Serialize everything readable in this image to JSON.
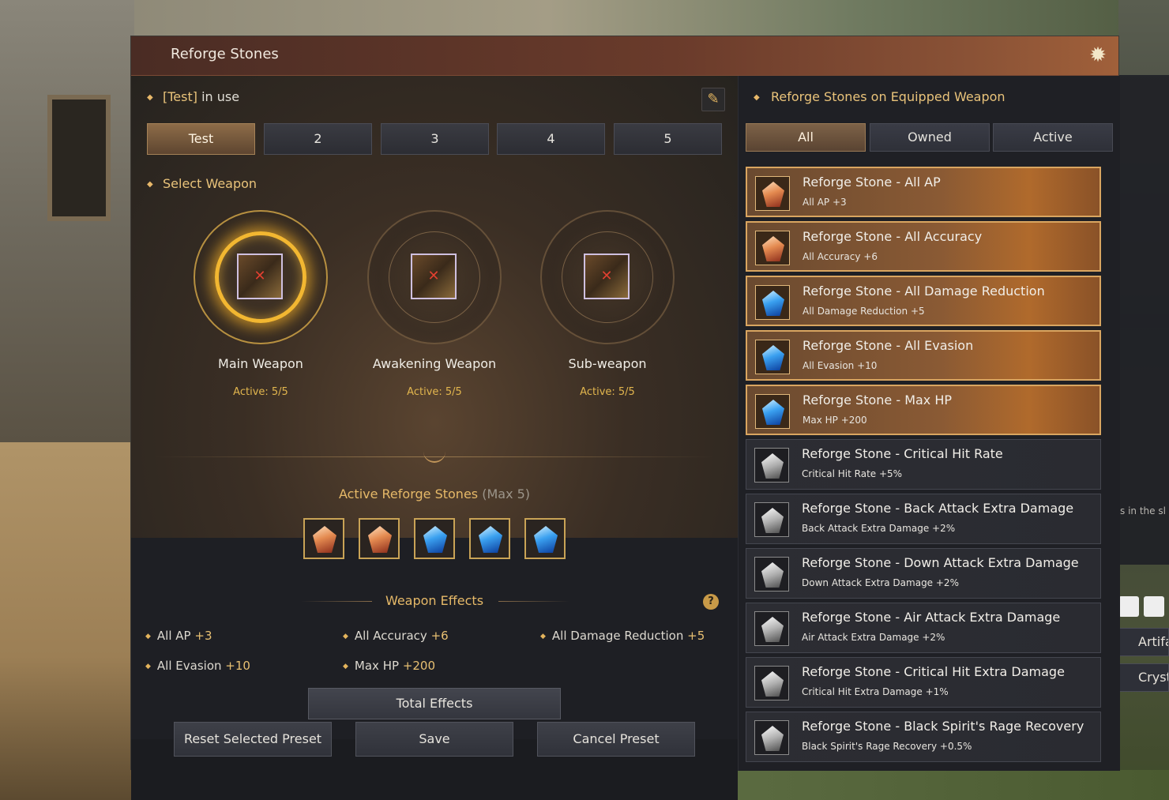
{
  "window": {
    "title": "Reforge Stones"
  },
  "preset": {
    "name": "[Test]",
    "in_use_label": "in use",
    "tabs": [
      "Test",
      "2",
      "3",
      "4",
      "5"
    ],
    "active_tab": 0
  },
  "select_weapon": {
    "label": "Select Weapon",
    "weapons": [
      {
        "name": "Main Weapon",
        "active": "Active: 5/5",
        "selected": true
      },
      {
        "name": "Awakening Weapon",
        "active": "Active: 5/5",
        "selected": false
      },
      {
        "name": "Sub-weapon",
        "active": "Active: 5/5",
        "selected": false
      }
    ]
  },
  "active_stones": {
    "title": "Active Reforge Stones",
    "max_label": "(Max 5)",
    "slots": [
      "red",
      "red",
      "blue",
      "blue",
      "blue"
    ]
  },
  "weapon_effects": {
    "title": "Weapon Effects",
    "items": [
      {
        "label": "All AP",
        "value": "+3"
      },
      {
        "label": "All Accuracy",
        "value": "+6"
      },
      {
        "label": "All Damage Reduction",
        "value": "+5"
      },
      {
        "label": "All Evasion",
        "value": "+10"
      },
      {
        "label": "Max HP",
        "value": "+200"
      }
    ],
    "total_button": "Total Effects"
  },
  "footer": {
    "reset": "Reset Selected Preset",
    "save": "Save",
    "cancel": "Cancel Preset"
  },
  "equipped": {
    "title": "Reforge Stones on Equipped Weapon",
    "filters": [
      "All",
      "Owned",
      "Active"
    ],
    "active_filter": 0,
    "stones": [
      {
        "name": "Reforge Stone - All AP",
        "desc": "All AP +3",
        "gem": "red",
        "active": true
      },
      {
        "name": "Reforge Stone - All Accuracy",
        "desc": "All Accuracy +6",
        "gem": "red",
        "active": true
      },
      {
        "name": "Reforge Stone - All Damage Reduction",
        "desc": "All Damage Reduction +5",
        "gem": "blue",
        "active": true
      },
      {
        "name": "Reforge Stone - All Evasion",
        "desc": "All Evasion +10",
        "gem": "blue",
        "active": true
      },
      {
        "name": "Reforge Stone - Max HP",
        "desc": "Max HP +200",
        "gem": "blue",
        "active": true
      },
      {
        "name": "Reforge Stone - Critical Hit Rate",
        "desc": "Critical Hit Rate +5%",
        "gem": "gray",
        "active": false
      },
      {
        "name": "Reforge Stone - Back Attack Extra Damage",
        "desc": "Back Attack Extra Damage +2%",
        "gem": "gray",
        "active": false
      },
      {
        "name": "Reforge Stone - Down Attack Extra Damage",
        "desc": "Down Attack Extra Damage +2%",
        "gem": "gray",
        "active": false
      },
      {
        "name": "Reforge Stone - Air Attack Extra Damage",
        "desc": "Air Attack Extra Damage +2%",
        "gem": "gray",
        "active": false
      },
      {
        "name": "Reforge Stone - Critical Hit Extra Damage",
        "desc": "Critical Hit Extra Damage +1%",
        "gem": "gray",
        "active": false
      },
      {
        "name": "Reforge Stone - Black Spirit's Rage Recovery",
        "desc": "Black Spirit's Rage Recovery +0.5%",
        "gem": "gray",
        "active": false
      }
    ]
  },
  "background": {
    "side_text": "s in the sl",
    "side_buttons": [
      "Artifa",
      "Cryst"
    ]
  }
}
